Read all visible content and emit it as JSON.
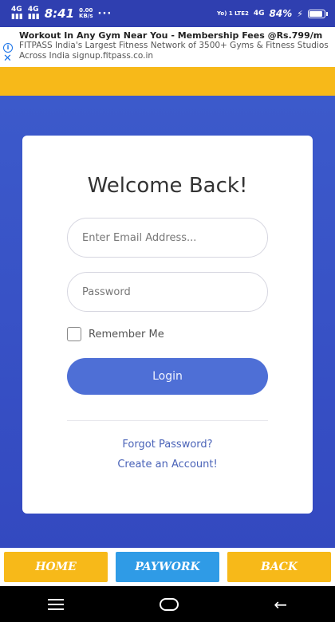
{
  "status_bar": {
    "net1": "4G",
    "net2": "4G",
    "time": "8:41",
    "speed_value": "0.00",
    "speed_unit": "KB/s",
    "dots": "···",
    "volte": "Yo) 1 LTE2",
    "net3": "4G",
    "battery_pct": "84%"
  },
  "ad": {
    "title": "Workout In Any Gym Near You - Membership Fees @Rs.799/m",
    "line1": "FITPASS India's Largest Fitness Network of 3500+ Gyms & Fitness Studios",
    "line2": "Across India signup.fitpass.co.in"
  },
  "login": {
    "title": "Welcome Back!",
    "email_placeholder": "Enter Email Address...",
    "password_placeholder": "Password",
    "remember_label": "Remember Me",
    "login_label": "Login",
    "forgot_link": "Forgot Password?",
    "create_link": "Create an Account!"
  },
  "bottom_nav": {
    "home": "HOME",
    "paywork": "PAYWORK",
    "back": "BACK"
  },
  "colors": {
    "primary_blue": "#3a55c8",
    "yellow": "#f7b919",
    "login_button": "#4e6fd6",
    "paywork_button": "#2f9be6"
  }
}
